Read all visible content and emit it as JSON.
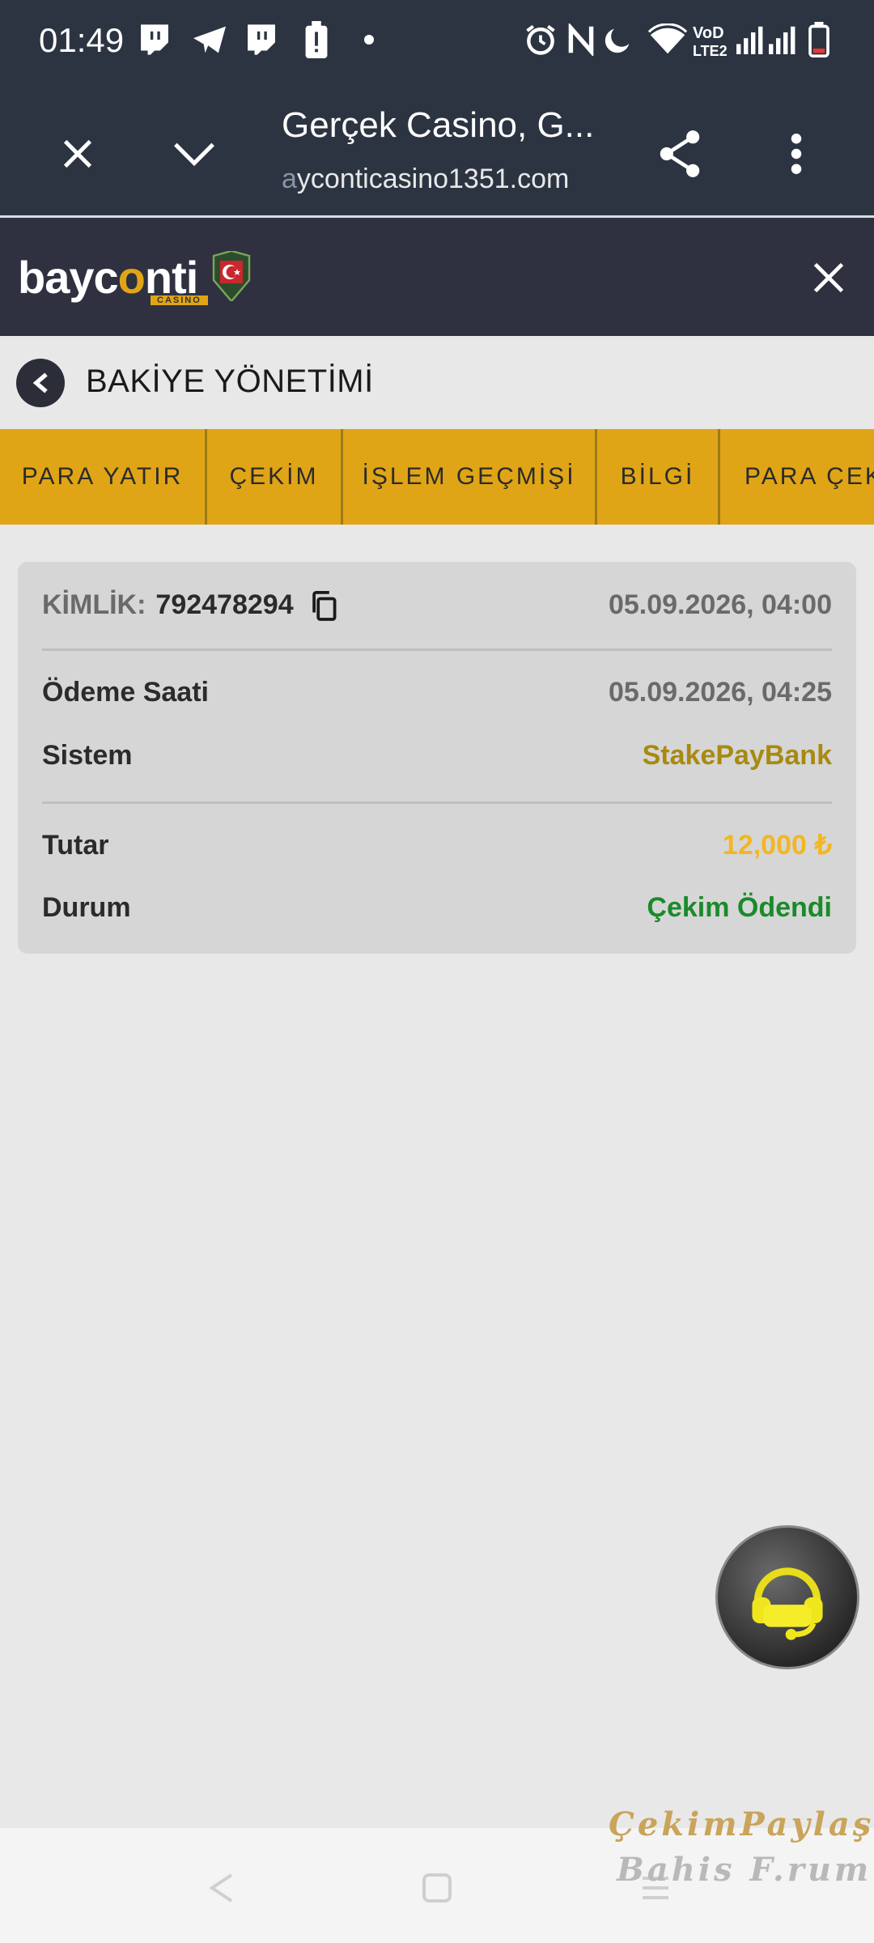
{
  "status_bar": {
    "time": "01:49"
  },
  "browser": {
    "page_title": "Gerçek Casino, G...",
    "url_prefix": "a",
    "url_main": "yconticasino1351.com"
  },
  "site": {
    "logo_text_pre": "bayc",
    "logo_text_o": "o",
    "logo_text_post": "nti",
    "logo_sub": "CASINO"
  },
  "section": {
    "title": "BAKİYE YÖNETİMİ"
  },
  "tabs": [
    {
      "label": "PARA YATIR"
    },
    {
      "label": "ÇEKİM"
    },
    {
      "label": "İŞLEM GEÇMİŞİ"
    },
    {
      "label": "BİLGİ"
    },
    {
      "label": "PARA ÇEKİM"
    }
  ],
  "transaction": {
    "id_label": "KİMLİK:",
    "id_value": "792478294",
    "created_at": "05.09.2026, 04:00",
    "payment_time_label": "Ödeme Saati",
    "payment_time_value": "05.09.2026, 04:25",
    "system_label": "Sistem",
    "system_value": "StakePayBank",
    "amount_label": "Tutar",
    "amount_value": "12,000 ₺",
    "status_label": "Durum",
    "status_value": "Çekim Ödendi"
  },
  "watermark": {
    "line1": "ÇekimPaylaş",
    "line2": "Bahis F.rum"
  },
  "colors": {
    "accent_gold": "#e0a516",
    "system_color": "#a88a10",
    "amount_color": "#f3b622",
    "status_green": "#1a8a2a",
    "header_bg": "#2f3140",
    "chrome_bg": "#2c3442"
  },
  "icons": {
    "status": [
      "twitch-icon",
      "telegram-icon",
      "twitch-icon",
      "battery-alert-icon",
      "dot-icon",
      "alarm-icon",
      "nfc-icon",
      "moon-icon",
      "wifi-icon",
      "volte-icon",
      "signal-icon",
      "signal-icon",
      "battery-icon"
    ],
    "browser": [
      "close-icon",
      "chevron-down-icon",
      "share-icon",
      "more-vert-icon"
    ]
  }
}
